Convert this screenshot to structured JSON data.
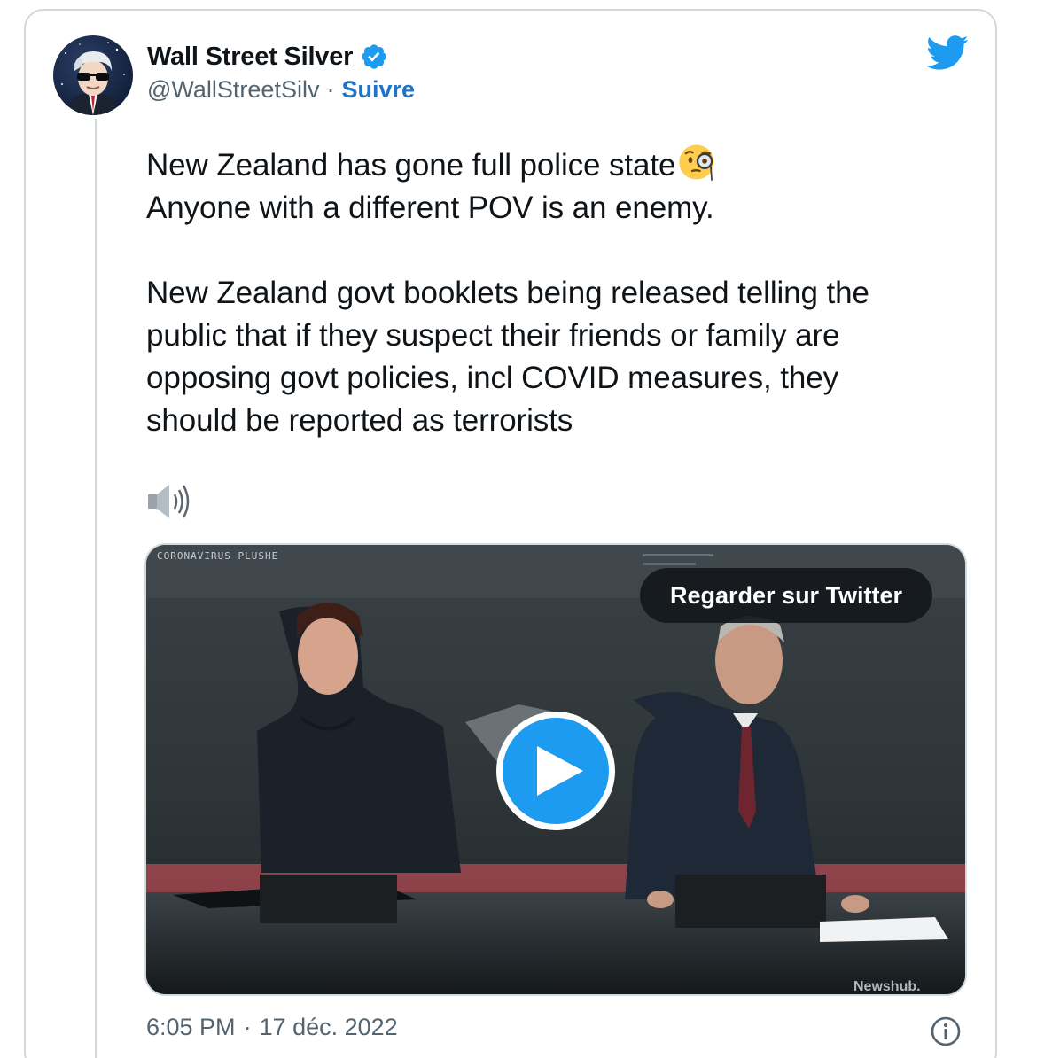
{
  "author": {
    "display_name": "Wall Street Silver",
    "handle": "@WallStreetSilv",
    "separator": "·",
    "follow_label": "Suivre",
    "verified": true
  },
  "tweet": {
    "lines": [
      "New Zealand has gone full police state",
      "Anyone with a different POV is an enemy.",
      "New Zealand govt booklets being released telling the",
      "public that if they suspect their friends or family are",
      "opposing govt policies, incl COVID measures, they",
      "should be reported as terrorists"
    ],
    "emoji": "face-with-monocle-icon"
  },
  "media": {
    "watch_label": "Regarder sur Twitter",
    "channel_tag": "CORONAVIRUS PLUSHE",
    "watermark": "Newshub."
  },
  "footer": {
    "time": "6:05 PM",
    "separator": "·",
    "date": "17 déc. 2022"
  },
  "colors": {
    "accent": "#1d9bf0",
    "follow": "#1f74c7",
    "secondary_text": "#536471",
    "border": "#cfd9de"
  }
}
